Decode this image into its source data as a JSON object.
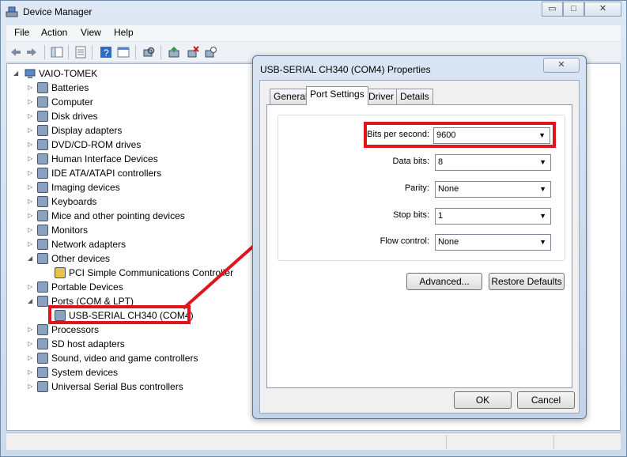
{
  "window": {
    "title": "Device Manager",
    "controls": {
      "minimize": "▭",
      "maximize": "□",
      "close": "✕"
    }
  },
  "menu": [
    "File",
    "Action",
    "View",
    "Help"
  ],
  "tree": {
    "root": "VAIO-TOMEK",
    "items": [
      {
        "label": "Batteries",
        "icon": "battery-icon"
      },
      {
        "label": "Computer",
        "icon": "computer-icon"
      },
      {
        "label": "Disk drives",
        "icon": "disk-drive-icon"
      },
      {
        "label": "Display adapters",
        "icon": "display-adapter-icon"
      },
      {
        "label": "DVD/CD-ROM drives",
        "icon": "dvd-drive-icon"
      },
      {
        "label": "Human Interface Devices",
        "icon": "hid-icon"
      },
      {
        "label": "IDE ATA/ATAPI controllers",
        "icon": "ide-controller-icon"
      },
      {
        "label": "Imaging devices",
        "icon": "camera-icon"
      },
      {
        "label": "Keyboards",
        "icon": "keyboard-icon"
      },
      {
        "label": "Mice and other pointing devices",
        "icon": "mouse-icon"
      },
      {
        "label": "Monitors",
        "icon": "monitor-icon"
      },
      {
        "label": "Network adapters",
        "icon": "network-icon"
      },
      {
        "label": "Other devices",
        "icon": "unknown-device-icon"
      },
      {
        "label": "PCI Simple Communications Controller",
        "icon": "warning-device-icon"
      },
      {
        "label": "Portable Devices",
        "icon": "portable-device-icon"
      },
      {
        "label": "Ports (COM & LPT)",
        "icon": "port-icon"
      },
      {
        "label": "USB-SERIAL CH340 (COM4)",
        "icon": "port-icon"
      },
      {
        "label": "Processors",
        "icon": "processor-icon"
      },
      {
        "label": "SD host adapters",
        "icon": "sd-card-icon"
      },
      {
        "label": "Sound, video and game controllers",
        "icon": "speaker-icon"
      },
      {
        "label": "System devices",
        "icon": "system-device-icon"
      },
      {
        "label": "Universal Serial Bus controllers",
        "icon": "usb-icon"
      }
    ]
  },
  "dialog": {
    "title": "USB-SERIAL CH340 (COM4) Properties",
    "close": "✕",
    "tabs": [
      "General",
      "Port Settings",
      "Driver",
      "Details"
    ],
    "active_tab": "Port Settings",
    "fields": [
      {
        "label": "Bits per second:",
        "value": "9600"
      },
      {
        "label": "Data bits:",
        "value": "8"
      },
      {
        "label": "Parity:",
        "value": "None"
      },
      {
        "label": "Stop bits:",
        "value": "1"
      },
      {
        "label": "Flow control:",
        "value": "None"
      }
    ],
    "buttons": {
      "advanced": "Advanced...",
      "restore": "Restore Defaults",
      "ok": "OK",
      "cancel": "Cancel"
    }
  },
  "colors": {
    "annotation": "#e0151b",
    "selection": "#cde8ff"
  }
}
